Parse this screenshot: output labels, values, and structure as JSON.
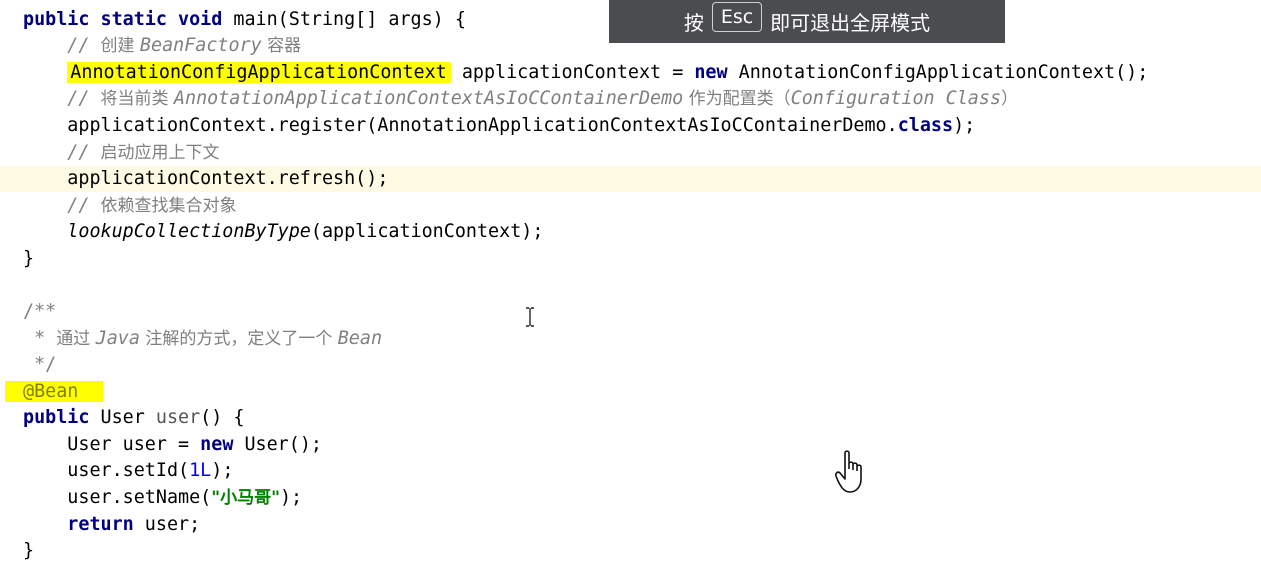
{
  "overlay": {
    "prefix": "按",
    "key": "Esc",
    "suffix": "即可退出全屏模式"
  },
  "code": {
    "l1": {
      "kw": "public static void",
      "rest": " main(String[] args) {"
    },
    "l2": {
      "indent": "    ",
      "slashes": "// ",
      "cn1": "创建 ",
      "ital": "BeanFactory",
      "cn2": " 容器"
    },
    "l3": {
      "indent": "    ",
      "hl": "AnnotationConfigApplicationContext",
      "mid": " applicationContext = ",
      "kw": "new",
      "rest": " AnnotationConfigApplicationContext();"
    },
    "l4": {
      "indent": "    ",
      "slashes": "// ",
      "cn1": "将当前类 ",
      "ital": "AnnotationApplicationContextAsIoCContainerDemo",
      "cn2": " 作为配置类（",
      "ital2": "Configuration Class",
      "cn3": "）"
    },
    "l5": {
      "indent": "    ",
      "pre": "applicationContext.register(AnnotationApplicationContextAsIoCContainerDemo.",
      "kw": "class",
      "post": ");"
    },
    "l6": {
      "indent": "    ",
      "slashes": "// ",
      "cn": "启动应用上下文"
    },
    "l7": {
      "indent": "    ",
      "text": "applicationContext.refresh();"
    },
    "l8": {
      "indent": "    ",
      "slashes": "// ",
      "cn": "依赖查找集合对象"
    },
    "l9": {
      "indent": "    ",
      "ital": "lookupCollectionByType",
      "rest": "(applicationContext);"
    },
    "l10": {
      "text": "}"
    },
    "l12": {
      "text": "/**"
    },
    "l13": {
      "star": " * ",
      "cn1": "通过 ",
      "ital": "Java",
      "cn2": " 注解的方式，定义了一个 ",
      "ital2": "Bean"
    },
    "l14": {
      "text": " */"
    },
    "l15": {
      "hl": "@Bean"
    },
    "l16": {
      "kw": "public",
      "mid": " User ",
      "method": "user",
      "rest": "() {"
    },
    "l17": {
      "indent": "    ",
      "pre": "User user = ",
      "kw": "new",
      "rest": " User();"
    },
    "l18": {
      "indent": "    ",
      "pre": "user.setId(",
      "num": "1L",
      "post": ");"
    },
    "l19": {
      "indent": "    ",
      "pre": "user.setName(",
      "str": "\"小马哥\"",
      "post": ");"
    },
    "l20": {
      "indent": "    ",
      "kw": "return",
      "rest": " user;"
    },
    "l21": {
      "text": "}"
    }
  },
  "icons": {
    "cursor_text": "ibeam-cursor-icon",
    "cursor_pointer": "hand-cursor-icon"
  }
}
